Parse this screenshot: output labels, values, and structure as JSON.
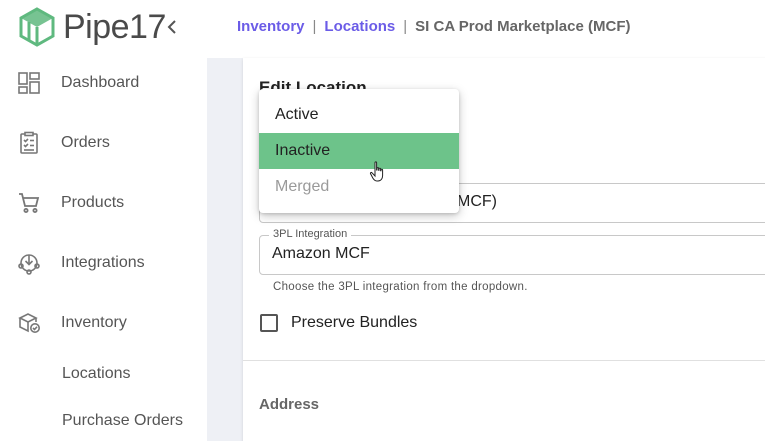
{
  "brand": {
    "name": "Pipe17",
    "accent": "#5fb97f"
  },
  "sidebar": {
    "collapse_icon": "chevron-left-icon",
    "items": [
      {
        "label": "Dashboard",
        "icon": "dashboard-icon"
      },
      {
        "label": "Orders",
        "icon": "orders-icon"
      },
      {
        "label": "Products",
        "icon": "cart-icon"
      },
      {
        "label": "Integrations",
        "icon": "integrations-icon"
      },
      {
        "label": "Inventory",
        "icon": "inventory-icon"
      }
    ],
    "sub_items": [
      {
        "label": "Locations"
      },
      {
        "label": "Purchase Orders"
      }
    ]
  },
  "breadcrumb": {
    "items": [
      "Inventory",
      "Locations"
    ],
    "separator": "|",
    "current": "SI CA Prod Marketplace (MCF)",
    "link_color": "#6b5ce7"
  },
  "form": {
    "title": "Edit Location",
    "name_value_visible": "MCF)",
    "integration_label": "3PL Integration",
    "integration_value": "Amazon MCF",
    "integration_helper": "Choose the 3PL integration from the dropdown.",
    "preserve_bundles_label": "Preserve Bundles",
    "address_section": "Address"
  },
  "dropdown": {
    "options": [
      {
        "label": "Active",
        "state": "normal"
      },
      {
        "label": "Inactive",
        "state": "selected"
      },
      {
        "label": "Merged",
        "state": "disabled"
      }
    ],
    "selected_color": "#6dc38a"
  }
}
